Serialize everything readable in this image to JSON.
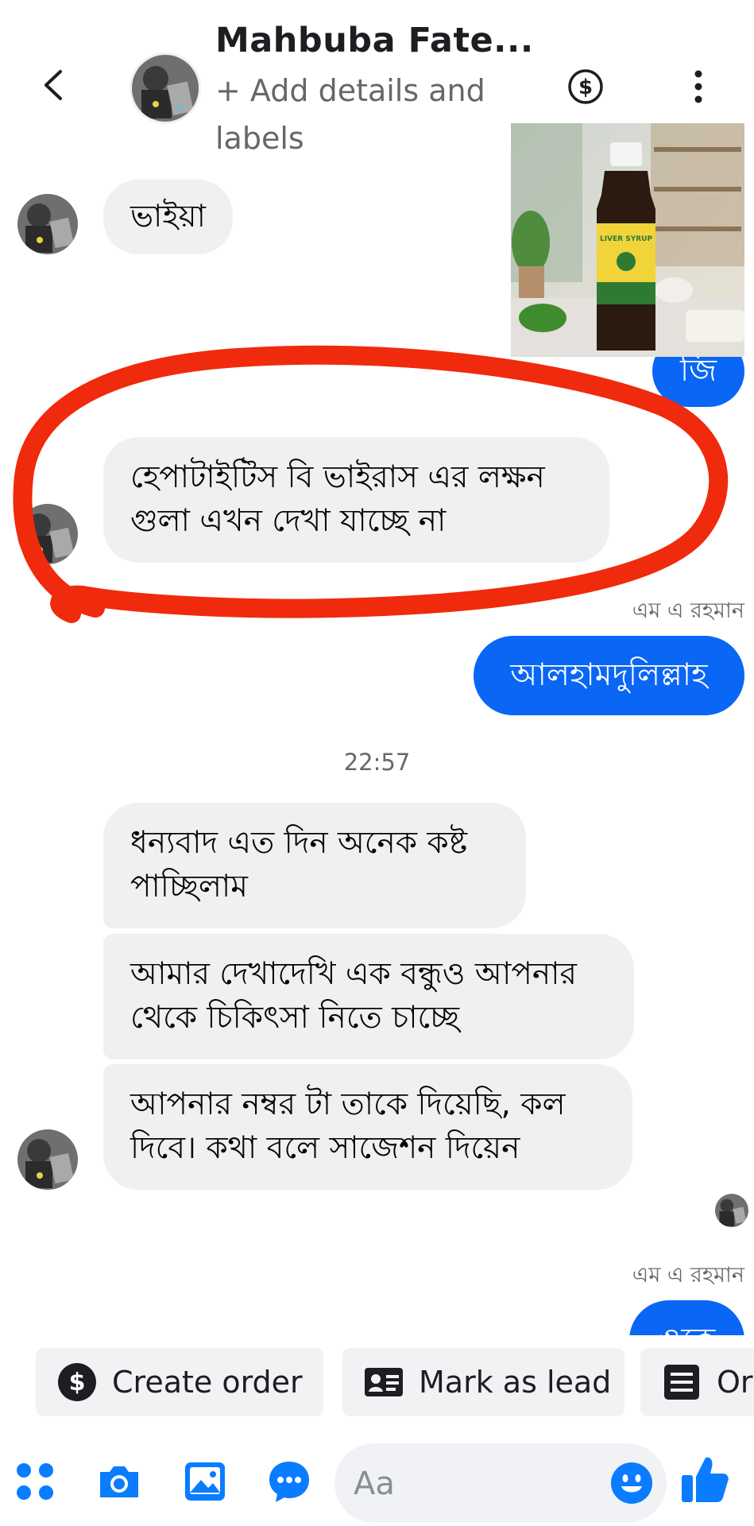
{
  "header": {
    "title": "Mahbuba Fate...",
    "subtitle": "+ Add details and labels",
    "back_icon": "chevron-left-icon",
    "payment_icon": "dollar-circle-icon",
    "more_icon": "more-vertical-icon"
  },
  "product_image": {
    "label_top": "LIVER SYRUP",
    "icon": "product-photo"
  },
  "messages": [
    {
      "direction": "incoming",
      "text": "ভাইয়া"
    },
    {
      "direction": "outgoing",
      "text": "জি"
    },
    {
      "direction": "incoming",
      "text": "হেপাটাইটিস বি ভাইরাস এর লক্ষন গুলা এখন দেখা যাচ্ছে না"
    },
    {
      "direction": "outgoing",
      "sender": "এম এ রহমান",
      "text": "আলহামদুলিল্লাহ"
    },
    {
      "direction": "incoming",
      "text": "ধন্যবাদ এত দিন অনেক কষ্ট পাচ্ছিলাম"
    },
    {
      "direction": "incoming",
      "text": "আমার দেখাদেখি এক বন্ধুও আপনার থেকে চিকিৎসা নিতে চাচ্ছে"
    },
    {
      "direction": "incoming",
      "text": "আপনার নম্বর টা তাকে দিয়েছি, কল দিবে। কথা বলে সাজেশন দিয়েন"
    },
    {
      "direction": "outgoing",
      "sender": "এম এ রহমান",
      "text": "ওকে"
    }
  ],
  "timestamp": "22:57",
  "actions": [
    {
      "label": "Create order",
      "icon": "dollar-circle-icon"
    },
    {
      "label": "Mark as lead",
      "icon": "contact-card-icon"
    },
    {
      "label": "Or",
      "icon": "list-document-icon"
    }
  ],
  "composer": {
    "placeholder": "Aa",
    "icons": [
      "apps-grid-icon",
      "camera-icon",
      "gallery-icon",
      "chat-bubble-icon",
      "emoji-icon",
      "thumbs-up-icon"
    ]
  },
  "colors": {
    "outgoing_bubble": "#0a66f5",
    "incoming_bubble": "#f0f0f3",
    "accent": "#0a7cff",
    "annotation": "#f02a0c"
  }
}
